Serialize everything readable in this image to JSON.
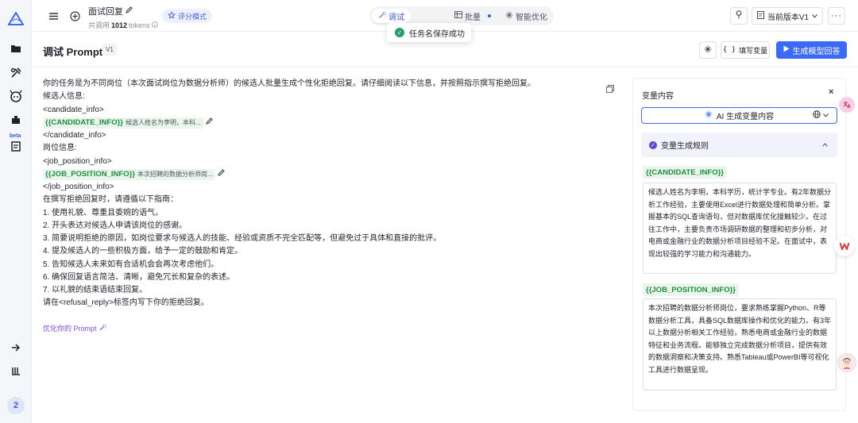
{
  "topbar": {
    "task_name": "面试回复",
    "token_prefix": "共调用",
    "token_count": "1012",
    "token_suffix": "tokens",
    "eval_mode": "评分模式",
    "tabs": [
      {
        "label": "调试"
      },
      {
        "label": "批量"
      },
      {
        "label": "智能优化"
      }
    ],
    "version_select": "当前版本V1"
  },
  "toast": {
    "message": "任务名保存成功"
  },
  "header": {
    "title": "调试 Prompt",
    "version_tag": "V1",
    "fill_vars_label": "填写变量",
    "generate_label": "生成模型回答"
  },
  "prompt": {
    "line_intro": "你的任务是为不同岗位（本次面试岗位为数据分析师）的候选人批量生成个性化拒绝回复。请仔细阅读以下信息，并按照指示撰写拒绝回复。",
    "line_cand_label": "候选人信息:",
    "line_cand_open": "<candidate_info>",
    "var1_name": "{{CANDIDATE_INFO}}",
    "var1_preview": "候选人姓名为李明，本科...",
    "line_cand_close": "</candidate_info>",
    "line_job_label": "岗位信息:",
    "line_job_open": "<job_position_info>",
    "var2_name": "{{JOB_POSITION_INFO}}",
    "var2_preview": "本次招聘的数据分析师岗...",
    "line_job_close": "</job_position_info>",
    "line_guide": "在撰写拒绝回复时，请遵循以下指南：",
    "guides": [
      "1. 使用礼貌、尊重且委婉的语气。",
      "2. 开头表达对候选人申请该岗位的感谢。",
      "3. 简要说明拒绝的原因，如岗位要求与候选人的技能、经验或资质不完全匹配等，但避免过于具体和直接的批评。",
      "4. 提及候选人的一些积极方面，给予一定的鼓励和肯定。",
      "5. 告知候选人未来如有合适机会会再次考虑他们。",
      "6. 确保回复语言简洁、清晰，避免冗长和复杂的表述。",
      "7. 以礼貌的结束语结束回复。"
    ],
    "line_final": "请在<refusal_reply>标签内写下你的拒绝回复。",
    "optimize_link": "优化你的 Prompt"
  },
  "panel": {
    "title": "变量内容",
    "ai_button": "AI 生成变量内容",
    "rule_label": "变量生成规则",
    "var1_label": "{{CANDIDATE_INFO}}",
    "var1_value": "候选人姓名为李明，本科学历，统计学专业。有2年数据分析工作经验，主要使用Excel进行数据处理和简单分析。掌握基本的SQL查询语句，但对数据库优化接触较少。在过往工作中，主要负责市场调研数据的整理和初步分析，对电商或金融行业的数据分析项目经验不足。在面试中，表现出较强的学习能力和沟通能力。",
    "var2_label": "{{JOB_POSITION_INFO}}",
    "var2_value": "本次招聘的数据分析师岗位，要求熟练掌握Python、R等数据分析工具，具备SQL数据库操作和优化的能力。有3年以上数据分析相关工作经验，熟悉电商或金融行业的数据特征和业务流程。能够独立完成数据分析项目，提供有效的数据洞察和决策支持。熟悉Tableau或PowerBI等可视化工具进行数据呈现。"
  },
  "rail": {
    "beta_label": "beta",
    "badge": "2"
  },
  "colors": {
    "accent": "#3b6bf6",
    "variable_green": "#1f8f3f",
    "variable_bg": "#eaf5ec",
    "link_purple": "#7a4ee8"
  }
}
